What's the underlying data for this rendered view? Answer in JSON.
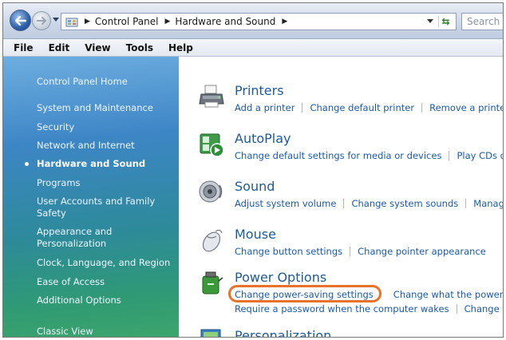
{
  "address_bar": {
    "breadcrumbs": [
      "Control Panel",
      "Hardware and Sound"
    ],
    "search_placeholder": "Search"
  },
  "menu": [
    "File",
    "Edit",
    "View",
    "Tools",
    "Help"
  ],
  "sidebar": {
    "items": [
      {
        "label": "Control Panel Home"
      },
      {
        "label": "System and Maintenance"
      },
      {
        "label": "Security"
      },
      {
        "label": "Network and Internet"
      },
      {
        "label": "Hardware and Sound",
        "current": true
      },
      {
        "label": "Programs"
      },
      {
        "label": "User Accounts and Family Safety"
      },
      {
        "label": "Appearance and Personalization"
      },
      {
        "label": "Clock, Language, and Region"
      },
      {
        "label": "Ease of Access"
      },
      {
        "label": "Additional Options"
      },
      {
        "label": "Classic View"
      }
    ]
  },
  "categories": [
    {
      "title": "Printers",
      "icon": "printer-icon",
      "links": [
        "Add a printer",
        "Change default printer",
        "Remove a printer"
      ],
      "links2": []
    },
    {
      "title": "AutoPlay",
      "icon": "autoplay-icon",
      "links": [
        "Change default settings for media or devices",
        "Play CDs or other media automatically"
      ],
      "links2": []
    },
    {
      "title": "Sound",
      "icon": "speaker-icon",
      "links": [
        "Adjust system volume",
        "Change system sounds",
        "Manage audio devices"
      ],
      "links2": []
    },
    {
      "title": "Mouse",
      "icon": "mouse-icon",
      "links": [
        "Change button settings",
        "Change pointer appearance"
      ],
      "links2": []
    },
    {
      "title": "Power Options",
      "icon": "power-options-icon",
      "links": [
        "Change power-saving settings",
        "Change what the power buttons do"
      ],
      "links2": [
        "Require a password when the computer wakes",
        "Change when the computer sleeps"
      ]
    }
  ],
  "partial_category": {
    "title": "Personalization"
  },
  "colors": {
    "highlight": "#e8722c",
    "link": "#1c5aa8",
    "title": "#1e5a96"
  }
}
